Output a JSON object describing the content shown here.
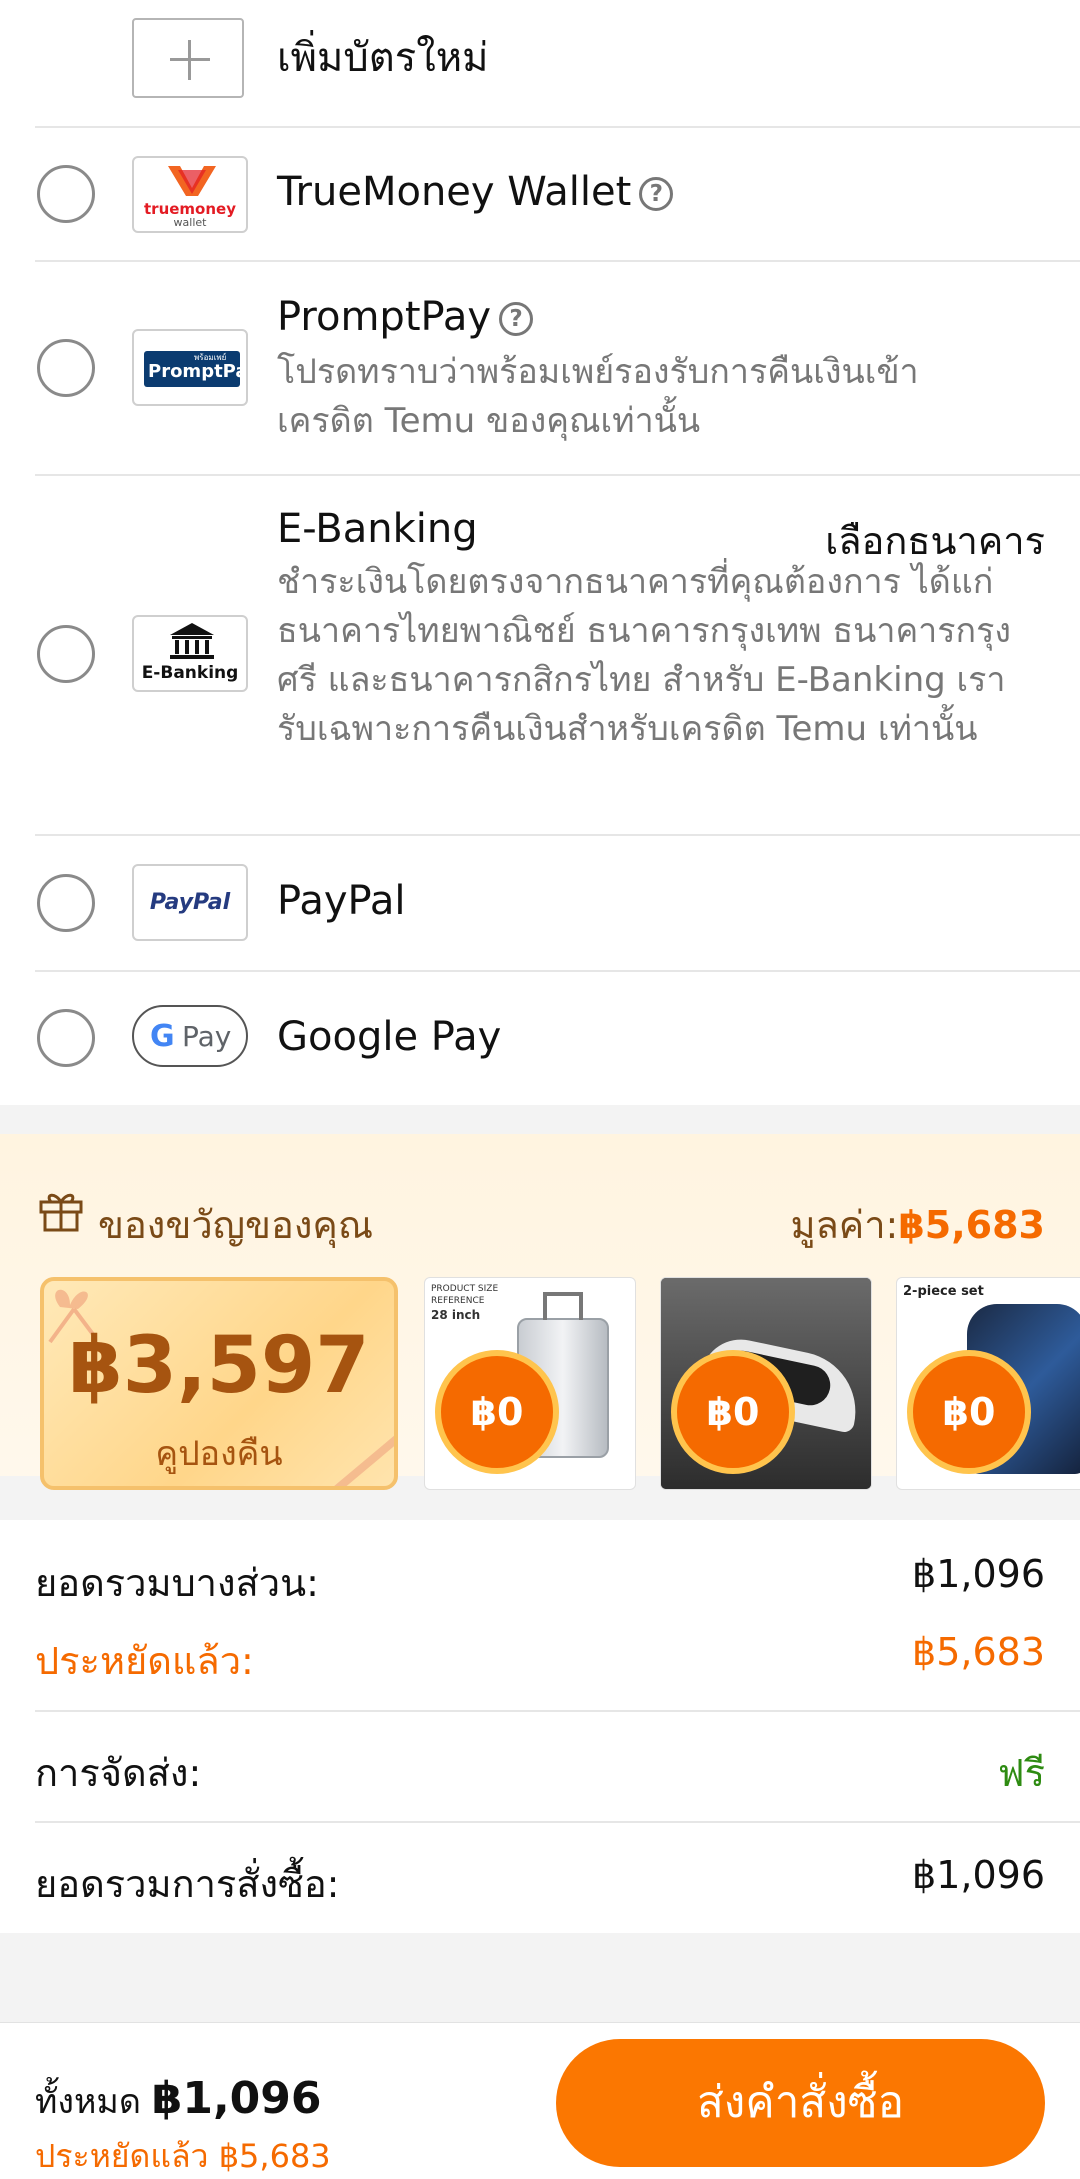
{
  "add_card": {
    "label": "เพิ่มบัตรใหม่"
  },
  "payment_methods": [
    {
      "name": "TrueMoney Wallet",
      "logo_text_top": "truemoney",
      "logo_text_bottom": "wallet"
    },
    {
      "name": "PromptPay",
      "logo_text": "PromptPay",
      "logo_small": "พร้อมเพย์",
      "desc": "โปรดทราบว่าพร้อมเพย์รองรับการคืนเงินเข้าเครดิต Temu ของคุณเท่านั้น"
    },
    {
      "name": "E-Banking",
      "logo_text": "E-Banking",
      "action": "เลือกธนาคาร",
      "desc": "ชำระเงินโดยตรงจากธนาคารที่คุณต้องการ ได้แก่ ธนาคารไทยพาณิชย์ ธนาคารกรุงเทพ ธนาคารกรุงศรี และธนาคารกสิกรไทย สำหรับ E-Banking เรารับเฉพาะการคืนเงินสำหรับเครดิต Temu เท่านั้น"
    },
    {
      "name": "PayPal",
      "logo_text": "PayPal"
    },
    {
      "name": "Google Pay",
      "logo_text": "Pay"
    }
  ],
  "gift": {
    "title": "ของขวัญของคุณ",
    "value_label": "มูลค่า:",
    "value_amount": "฿5,683",
    "coupon_amount": "฿3,597",
    "coupon_label": "คูปองคืน",
    "products": [
      {
        "price": "฿0",
        "caption_1": "PRODUCT SIZE",
        "caption_2": "REFERENCE",
        "caption_3": "28 inch"
      },
      {
        "price": "฿0"
      },
      {
        "price": "฿0",
        "caption_1": "2-piece set"
      }
    ]
  },
  "summary": {
    "subtotal_label": "ยอดรวมบางส่วน:",
    "subtotal_value": "฿1,096",
    "saved_label": "ประหยัดแล้ว:",
    "saved_value": "฿5,683",
    "shipping_label": "การจัดส่ง:",
    "shipping_value": "ฟรี",
    "order_total_label": "ยอดรวมการสั่งซื้อ:",
    "order_total_value": "฿1,096"
  },
  "bottom": {
    "total_label": "ทั้งหมด",
    "total_value": "฿1,096",
    "saved_text": "ประหยัดแล้ว ฿5,683",
    "order_button": "ส่งคำสั่งซื้อ"
  },
  "colors": {
    "accent": "#fb7701",
    "green": "#2e8b12",
    "gift_brown": "#7a4a17"
  },
  "icons": [
    "plus-icon",
    "help-icon",
    "bank-icon",
    "gift-icon",
    "google-g-icon",
    "paypal-icon"
  ]
}
